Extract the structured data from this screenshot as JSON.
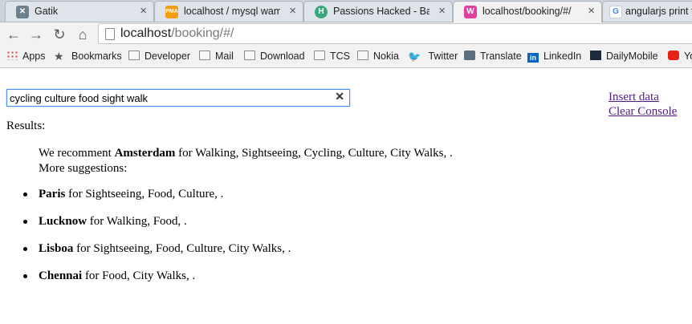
{
  "browser": {
    "tabs": [
      {
        "title": "Gatik",
        "favicon": "gatik-icon",
        "color": "#6b7f8c",
        "active": false
      },
      {
        "title": "localhost / mysql wamps",
        "favicon": "phpmyadmin-icon",
        "color": "#f29c11",
        "active": false
      },
      {
        "title": "Passions Hacked - Back",
        "favicon": "passions-hacked-icon",
        "color": "#3aa67b",
        "active": false
      },
      {
        "title": "localhost/booking/#/",
        "favicon": "booking-app-icon",
        "color": "#e040a0",
        "active": true
      },
      {
        "title": "angularjs print fri",
        "favicon": "google-icon",
        "color": "#4285f4",
        "active": false
      }
    ],
    "url_host": "localhost",
    "url_path": "/booking/#/",
    "bookmarks": [
      {
        "label": "Apps",
        "icon": "apps-icon"
      },
      {
        "label": "Bookmarks",
        "icon": "star-icon"
      },
      {
        "label": "Developer",
        "icon": "folder-icon"
      },
      {
        "label": "Mail",
        "icon": "folder-icon"
      },
      {
        "label": "Download",
        "icon": "folder-icon"
      },
      {
        "label": "TCS",
        "icon": "folder-icon"
      },
      {
        "label": "Nokia",
        "icon": "folder-icon"
      },
      {
        "label": "Twitter",
        "icon": "twitter-icon"
      },
      {
        "label": "Translate",
        "icon": "translate-icon"
      },
      {
        "label": "LinkedIn",
        "icon": "linkedin-icon"
      },
      {
        "label": "DailyMobile",
        "icon": "dailymobile-icon"
      },
      {
        "label": "Yo",
        "icon": "youtube-icon"
      }
    ]
  },
  "page": {
    "search_value": "cycling culture food sight walk",
    "clear_symbol": "✕",
    "insert_data_link": "Insert data",
    "clear_console_link": "Clear Console",
    "results_label": "Results:",
    "recommendation": {
      "prefix": "We recomment ",
      "city": "Amsterdam",
      "suffix": " for Walking, Sightseeing, Cycling, Culture, City Walks, ."
    },
    "more_suggestions_label": "More suggestions:",
    "suggestions": [
      {
        "city": "Paris",
        "text": " for Sightseeing, Food, Culture, ."
      },
      {
        "city": "Lucknow",
        "text": " for Walking, Food, ."
      },
      {
        "city": "Lisboa",
        "text": " for Sightseeing, Food, Culture, City Walks, ."
      },
      {
        "city": "Chennai",
        "text": " for Food, City Walks, ."
      }
    ]
  }
}
